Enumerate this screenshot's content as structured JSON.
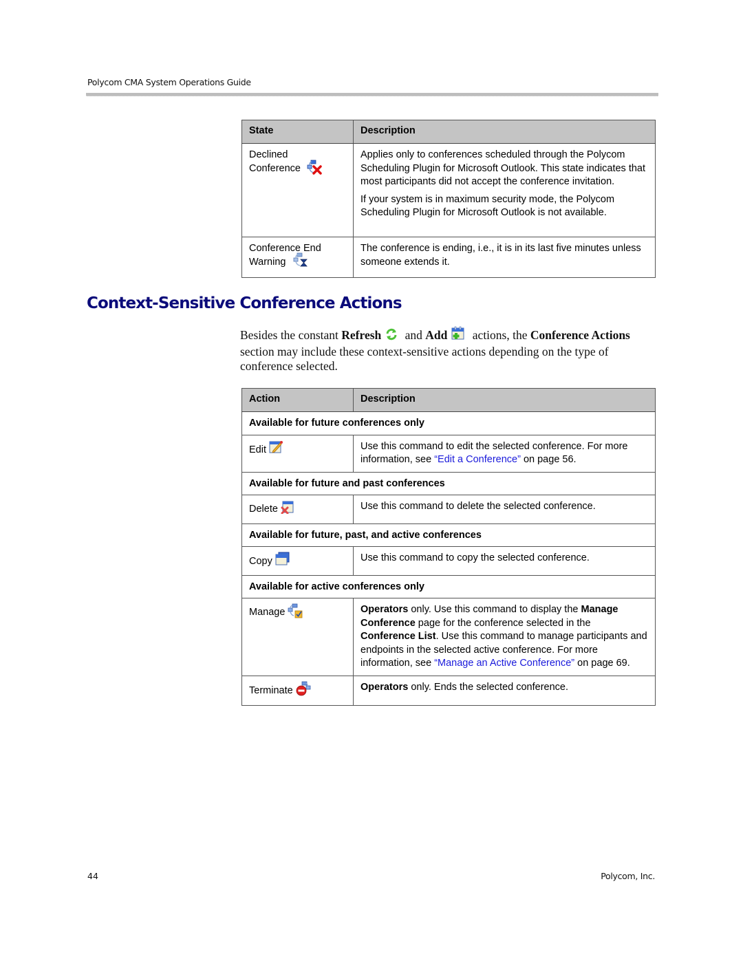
{
  "running_header": "Polycom CMA System Operations Guide",
  "states_table": {
    "headers": [
      "State",
      "Description"
    ],
    "rows": [
      {
        "state": "Declined Conference",
        "icon": "declined-conference-icon",
        "description": [
          "Applies only to conferences scheduled through the Polycom Scheduling Plugin for Microsoft Outlook. This state indicates that most participants did not accept the conference invitation.",
          "If your system is in maximum security mode, the Polycom Scheduling Plugin for Microsoft Outlook is not available."
        ]
      },
      {
        "state": "Conference End Warning",
        "icon": "conference-end-warning-icon",
        "description": [
          "The conference is ending, i.e., it is in its last five minutes unless someone extends it."
        ]
      }
    ]
  },
  "section": {
    "title": "Context-Sensitive Conference Actions",
    "intro": {
      "part1": "Besides the constant ",
      "refresh": "Refresh",
      "part2": " and ",
      "add": "Add",
      "part3": " actions, the ",
      "conference_actions": "Conference Actions",
      "part4": " section may include these context-sensitive actions depending on the type of conference selected."
    }
  },
  "actions_table": {
    "headers": [
      "Action",
      "Description"
    ],
    "groups": [
      {
        "label": "Available for future conferences only",
        "actions": [
          {
            "name": "Edit",
            "icon": "edit-icon",
            "desc_pre": "Use this command to edit the selected conference. For more information, see ",
            "link": "“Edit a Conference”",
            "desc_post": " on page 56."
          }
        ]
      },
      {
        "label": "Available for future and past conferences",
        "actions": [
          {
            "name": "Delete",
            "icon": "delete-icon",
            "desc": "Use this command to delete the selected conference."
          }
        ]
      },
      {
        "label": "Available for future, past, and active conferences",
        "actions": [
          {
            "name": "Copy",
            "icon": "copy-icon",
            "desc": "Use this command to copy the selected conference."
          }
        ]
      },
      {
        "label": "Available for active conferences only",
        "actions": [
          {
            "name": "Manage",
            "icon": "manage-icon",
            "b1": "Operators",
            "t1": " only. Use this command to display the ",
            "b2": "Manage Conference",
            "t2": " page for the conference selected in the ",
            "b3": "Conference List",
            "t3": ". Use this command to manage participants and endpoints in the selected active conference. For more information, see ",
            "link": "“Manage an Active Conference”",
            "t4": " on page 69."
          },
          {
            "name": "Terminate",
            "icon": "terminate-icon",
            "b1": "Operators",
            "t1": " only. Ends the selected conference."
          }
        ]
      }
    ]
  },
  "footer": {
    "page_number": "44",
    "company": "Polycom, Inc."
  }
}
